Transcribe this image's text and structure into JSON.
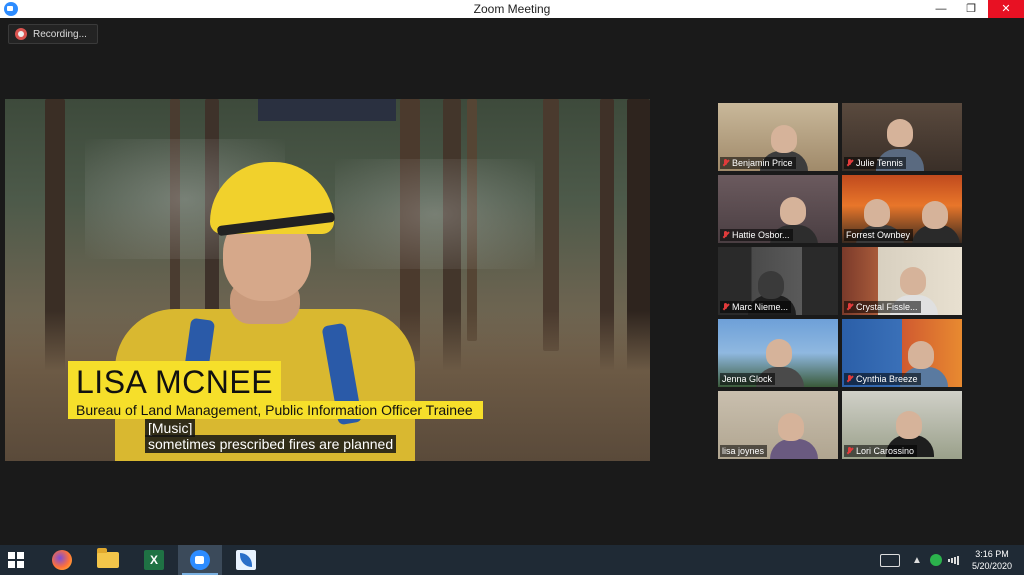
{
  "window": {
    "title": "Zoom Meeting"
  },
  "window_controls": {
    "minimize": "—",
    "maximize": "❐",
    "close": "✕"
  },
  "recording": {
    "label": "Recording..."
  },
  "shared_video": {
    "lower_third_name": "LISA MCNEE",
    "lower_third_org": "Bureau of Land Management, Public Information Officer Trainee",
    "caption_line1": "[Music]",
    "caption_line2": "sometimes prescribed fires are planned"
  },
  "participants": [
    {
      "name": "Benjamin Price",
      "muted": true
    },
    {
      "name": "Julie Tennis",
      "muted": true
    },
    {
      "name": "Hattie Osbor...",
      "muted": true
    },
    {
      "name": "Forrest Ownbey",
      "muted": false,
      "active_speaker": true
    },
    {
      "name": "Marc Nieme...",
      "muted": true
    },
    {
      "name": "Crystal Fissle...",
      "muted": true
    },
    {
      "name": "Jenna Glock",
      "muted": false
    },
    {
      "name": "Cynthia Breeze",
      "muted": true
    },
    {
      "name": "lisa joynes",
      "muted": false
    },
    {
      "name": "Lori Carossino",
      "muted": true
    }
  ],
  "taskbar": {
    "apps": [
      "windows-start",
      "firefox",
      "file-explorer",
      "excel",
      "zoom",
      "feather-app"
    ],
    "active_app": "zoom",
    "time": "3:16 PM",
    "date": "5/20/2020"
  },
  "colors": {
    "active_speaker_border": "#b9e42f",
    "lower_third_bg": "#f6df2a",
    "close_button": "#e81123",
    "muted_icon": "#e23b3b"
  }
}
